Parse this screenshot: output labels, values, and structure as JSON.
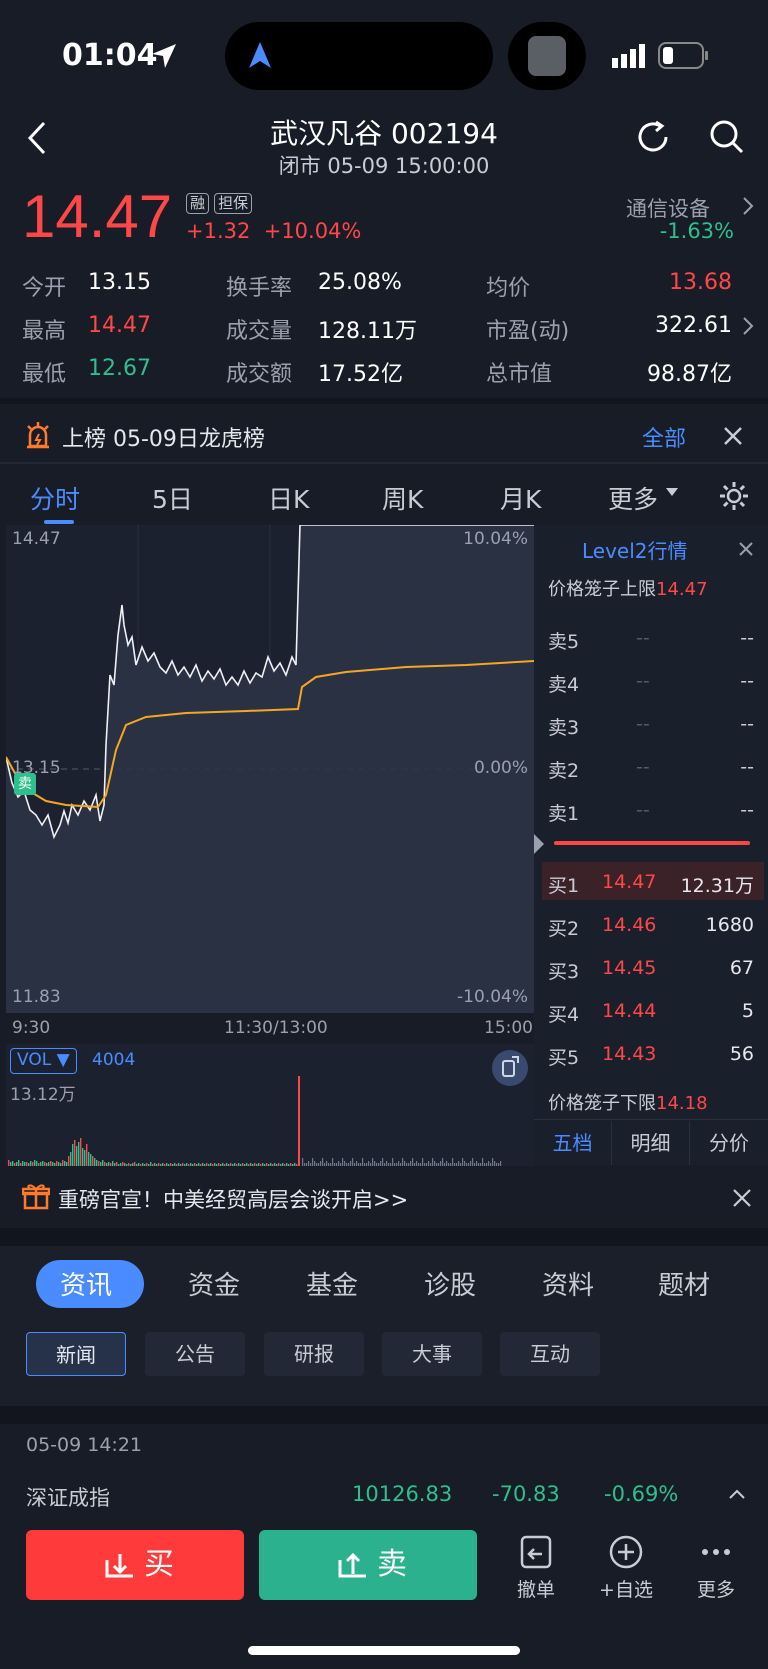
{
  "status": {
    "time": "01:04"
  },
  "header": {
    "title": "武汉凡谷 002194",
    "subtitle": "闭市 05-09 15:00:00"
  },
  "quote": {
    "price": "14.47",
    "badge_margin": "融",
    "badge_guarantee": "担保",
    "change": "+1.32",
    "change_pct": "+10.04%",
    "sector": "通信设备",
    "sector_change": "-1.63%"
  },
  "stats": [
    {
      "label": "今开",
      "value": "13.15",
      "color": "white"
    },
    {
      "label": "换手率",
      "value": "25.08%",
      "color": "white"
    },
    {
      "label": "均价",
      "value": "13.68",
      "color": "red"
    },
    {
      "label": "最高",
      "value": "14.47",
      "color": "red"
    },
    {
      "label": "成交量",
      "value": "128.11万",
      "color": "white"
    },
    {
      "label": "市盈(动)",
      "value": "322.61",
      "color": "white"
    },
    {
      "label": "最低",
      "value": "12.67",
      "color": "green"
    },
    {
      "label": "成交额",
      "value": "17.52亿",
      "color": "white"
    },
    {
      "label": "总市值",
      "value": "98.87亿",
      "color": "white"
    }
  ],
  "banner": {
    "text": "上榜 05-09日龙虎榜",
    "link": "全部"
  },
  "ktabs": [
    "分时",
    "5日",
    "日K",
    "周K",
    "月K",
    "更多"
  ],
  "chart": {
    "y_top": "14.47",
    "y_mid": "13.15",
    "y_bot": "11.83",
    "pct_top": "10.04%",
    "pct_mid": "0.00%",
    "pct_bot": "-10.04%",
    "x_labels": [
      "9:30",
      "11:30/13:00",
      "15:00"
    ],
    "sell_marker": "卖",
    "vol_label": "VOL",
    "vol_value": "4004",
    "vol_max": "13.12万"
  },
  "level2": {
    "title": "Level2行情",
    "upper_label": "价格笼子上限",
    "upper": "14.47",
    "lower_label": "价格笼子下限",
    "lower": "14.18",
    "asks": [
      {
        "l": "卖5",
        "p": "--",
        "v": "--"
      },
      {
        "l": "卖4",
        "p": "--",
        "v": "--"
      },
      {
        "l": "卖3",
        "p": "--",
        "v": "--"
      },
      {
        "l": "卖2",
        "p": "--",
        "v": "--"
      },
      {
        "l": "卖1",
        "p": "--",
        "v": "--"
      }
    ],
    "bids": [
      {
        "l": "买1",
        "p": "14.47",
        "v": "12.31万"
      },
      {
        "l": "买2",
        "p": "14.46",
        "v": "1680"
      },
      {
        "l": "买3",
        "p": "14.45",
        "v": "67"
      },
      {
        "l": "买4",
        "p": "14.44",
        "v": "5"
      },
      {
        "l": "买5",
        "p": "14.43",
        "v": "56"
      }
    ],
    "tabs": [
      "五档",
      "明细",
      "分价"
    ]
  },
  "notice": {
    "text": "重磅官宣！中美经贸高层会谈开启>>"
  },
  "section_tabs": [
    "资讯",
    "资金",
    "基金",
    "诊股",
    "资料",
    "题材"
  ],
  "news_tabs": [
    "新闻",
    "公告",
    "研报",
    "大事",
    "互动"
  ],
  "news": {
    "time": "05-09 14:21",
    "index_name": "深证成指",
    "index_value": "10126.83",
    "index_change": "-70.83",
    "index_pct": "-0.69%"
  },
  "actions": {
    "buy": "买",
    "sell": "卖",
    "cancel": "撤单",
    "watch": "+自选",
    "more": "更多"
  }
}
